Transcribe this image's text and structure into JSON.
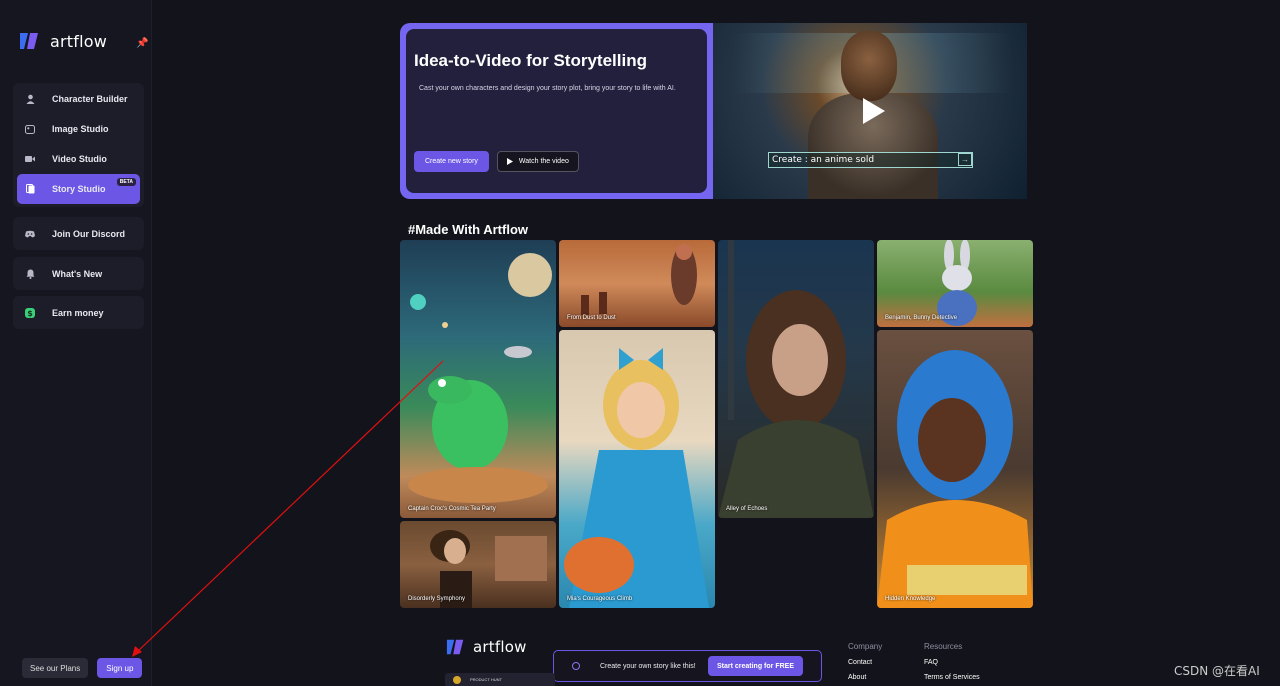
{
  "app": {
    "name": "artflow"
  },
  "sidebar": {
    "items": [
      {
        "label": "Character Builder",
        "icon": "user-icon"
      },
      {
        "label": "Image Studio",
        "icon": "image-icon"
      },
      {
        "label": "Video Studio",
        "icon": "video-icon"
      },
      {
        "label": "Story Studio",
        "icon": "book-icon",
        "badge": "BETA",
        "active": true
      }
    ],
    "discord_label": "Join Our Discord",
    "whats_new_label": "What's New",
    "earn_label": "Earn money",
    "plans_label": "See our Plans",
    "signup_label": "Sign up"
  },
  "hero": {
    "title": "Idea-to-Video for Storytelling",
    "subtitle": "Cast your own characters and design your story plot, bring your story to life with AI.",
    "create_label": "Create new story",
    "watch_label": "Watch the video",
    "prompt_text": "Create : an anime sold"
  },
  "gallery": {
    "title": "#Made With Artflow",
    "tiles": [
      {
        "caption": "Captain Croc's Cosmic Tea Party"
      },
      {
        "caption": "From Dust to Dust"
      },
      {
        "caption": "Mia's Courageous Climb"
      },
      {
        "caption": "Alley of Echoes"
      },
      {
        "caption": "Benjamin, Bunny Detective"
      },
      {
        "caption": "Hidden Knowledge"
      },
      {
        "caption": "Disorderly Symphony"
      }
    ]
  },
  "footer": {
    "cta_text": "Create your own story like this!",
    "cta_button": "Start creating for FREE",
    "company_heading": "Company",
    "company_links": [
      "Contact",
      "About"
    ],
    "resources_heading": "Resources",
    "resources_links": [
      "FAQ",
      "Terms of Services"
    ],
    "product_hunt": "PRODUCT HUNT"
  },
  "watermark": "CSDN @在看AI",
  "colors": {
    "accent": "#6c56e6",
    "background": "#13131b",
    "sidebar": "#161621",
    "annotation_arrow": "#e01010"
  }
}
